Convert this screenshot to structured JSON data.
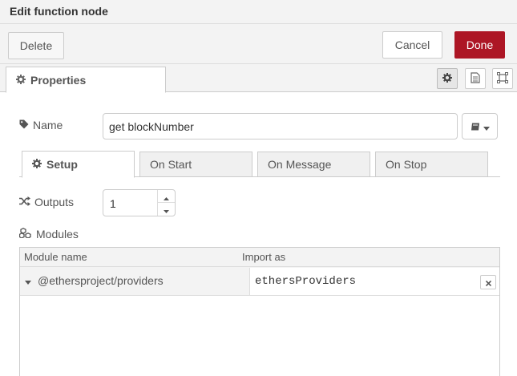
{
  "dialog": {
    "title": "Edit function node"
  },
  "buttons": {
    "delete": "Delete",
    "cancel": "Cancel",
    "done": "Done"
  },
  "tabs": {
    "properties": "Properties",
    "icons": [
      "gear-icon",
      "document-icon",
      "frame-icon"
    ]
  },
  "name": {
    "label": "Name",
    "value": "get blockNumber"
  },
  "subtabs": [
    {
      "label": "Setup",
      "active": true
    },
    {
      "label": "On Start",
      "active": false
    },
    {
      "label": "On Message",
      "active": false
    },
    {
      "label": "On Stop",
      "active": false
    }
  ],
  "outputs": {
    "label": "Outputs",
    "value": "1"
  },
  "modules": {
    "label": "Modules",
    "columns": [
      "Module name",
      "Import as"
    ],
    "rows": [
      {
        "module": "@ethersproject/providers",
        "import_as": "ethersProviders"
      }
    ]
  },
  "colors": {
    "done_button": "#ad1625",
    "toolbar_bg": "#f3f3f3",
    "border": "#cccccc"
  }
}
